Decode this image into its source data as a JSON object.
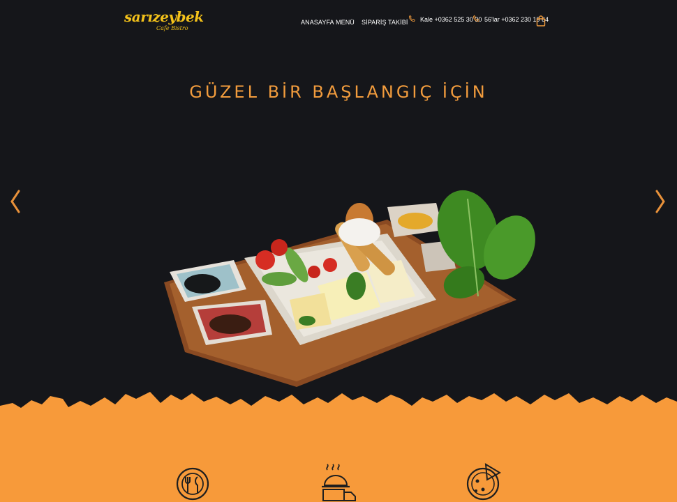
{
  "header": {
    "logo_text": "sarızeybek",
    "logo_sub": "Cafe Bistro",
    "nav": [
      "ANASAYFA",
      "MENÜ",
      "SİPARİŞ TAKİBİ"
    ],
    "phones": [
      "Kale +0362 525 30 30",
      "56'lar +0362 230 19 64"
    ]
  },
  "hero": {
    "headline": "GÜZEL BİR BAŞLANGIÇ İÇİN"
  },
  "colors": {
    "background": "#141518",
    "accent_orange": "#f79a3a",
    "logo_yellow": "#f4c21a",
    "headline_orange": "#f29c3d"
  },
  "icons": [
    "phone-icon",
    "cart-icon",
    "arrow-left-icon",
    "arrow-right-icon",
    "cutlery-icon",
    "delivery-icon",
    "pizza-icon"
  ]
}
